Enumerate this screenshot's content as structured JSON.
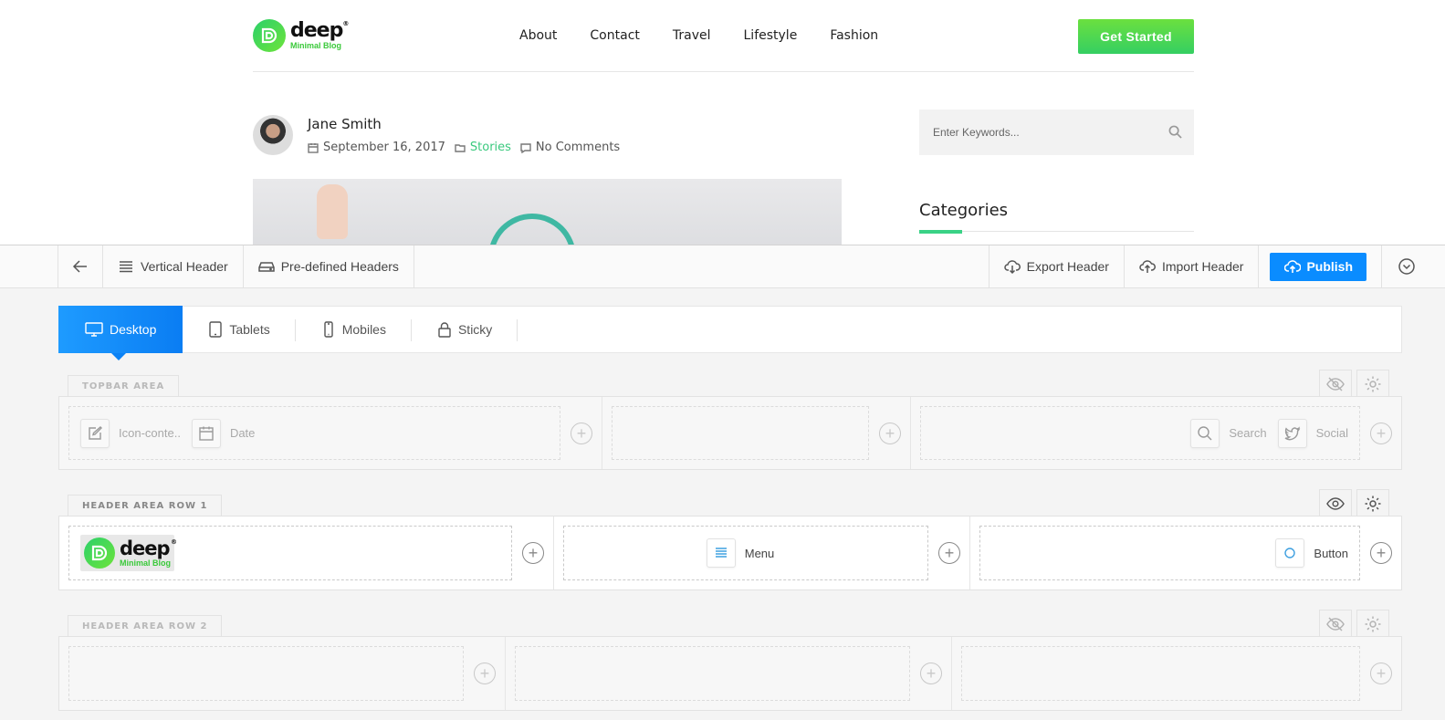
{
  "site": {
    "logo": {
      "word": "deep",
      "reg": "®",
      "tagline": "Minimal Blog"
    },
    "nav": [
      "About",
      "Contact",
      "Travel",
      "Lifestyle",
      "Fashion"
    ],
    "cta_label": "Get Started",
    "post": {
      "author": "Jane Smith",
      "date": "September 16, 2017",
      "category": "Stories",
      "comments": "No Comments"
    },
    "search_placeholder": "Enter Keywords...",
    "sidebar_title": "Categories",
    "accent_color": "#3ad286"
  },
  "builder": {
    "toolbar": {
      "vertical_header": "Vertical Header",
      "predefined_headers": "Pre-defined Headers",
      "export_header": "Export Header",
      "import_header": "Import Header",
      "publish": "Publish"
    },
    "tabs": [
      "Desktop",
      "Tablets",
      "Mobiles",
      "Sticky"
    ],
    "active_tab": "Desktop",
    "primary_color": "#0a8cff",
    "areas": {
      "topbar": {
        "label": "TOPBAR AREA",
        "visible": false,
        "left_elements": [
          "Icon-conte..",
          "Date"
        ],
        "right_elements": [
          "Search",
          "Social"
        ]
      },
      "row1": {
        "label": "HEADER AREA ROW 1",
        "visible": true,
        "center_element": "Menu",
        "right_element": "Button"
      },
      "row2": {
        "label": "HEADER AREA ROW 2",
        "visible": false
      }
    }
  }
}
